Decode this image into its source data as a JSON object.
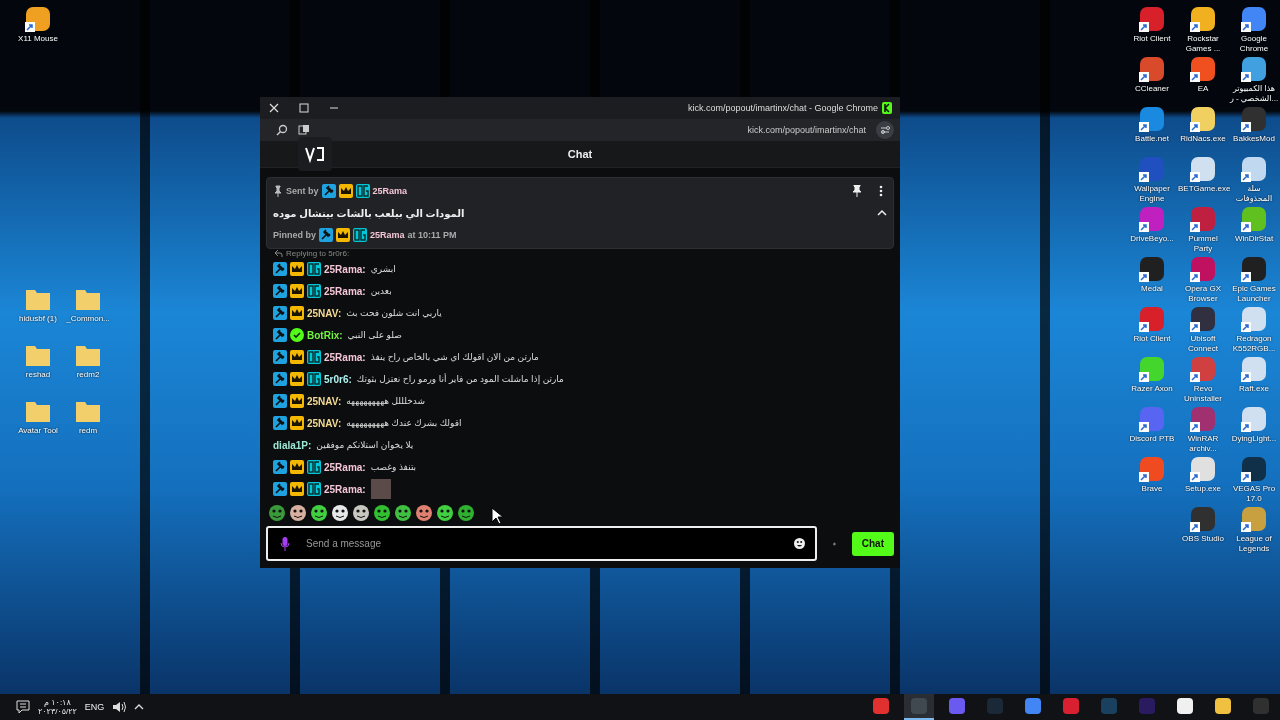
{
  "desktop": {
    "top_left_icons": [
      {
        "label": "X11 Mouse",
        "kind": "app",
        "color": "#f0a020"
      }
    ],
    "folder_icons": [
      {
        "label": "hidusbf (1)",
        "kind": "folder",
        "color": "#f2cf6a"
      },
      {
        "label": "_Common...",
        "kind": "folder",
        "color": "#f2cf6a"
      },
      {
        "label": "reshad",
        "kind": "folder",
        "color": "#f2cf6a"
      },
      {
        "label": "redm2",
        "kind": "folder",
        "color": "#f2cf6a"
      },
      {
        "label": "Avatar Tool",
        "kind": "folder",
        "color": "#f2cf6a"
      },
      {
        "label": "redm",
        "kind": "folder",
        "color": "#f2cf6a"
      }
    ],
    "icon_columns": [
      [
        {
          "label": "Riot Client",
          "kind": "app",
          "color": "#d8202a"
        },
        {
          "label": "CCleaner",
          "kind": "app",
          "color": "#d84a2a"
        },
        {
          "label": "Battle.net",
          "kind": "app",
          "color": "#1a8ae0"
        },
        {
          "label": "Wallpaper Engine",
          "kind": "app",
          "color": "#2050c0"
        },
        {
          "label": "DriveBeyo...",
          "kind": "app",
          "color": "#c020c0"
        },
        {
          "label": "Medal",
          "kind": "app",
          "color": "#202020"
        },
        {
          "label": "Riot Client",
          "kind": "app",
          "color": "#d8202a"
        },
        {
          "label": "Razer Axon",
          "kind": "app",
          "color": "#44d62c"
        },
        {
          "label": "Discord PTB",
          "kind": "app",
          "color": "#5865f2"
        },
        {
          "label": "Brave",
          "kind": "app",
          "color": "#f04a20"
        }
      ],
      [
        {
          "label": "Rockstar Games ...",
          "kind": "app",
          "color": "#f0b020"
        },
        {
          "label": "EA",
          "kind": "app",
          "color": "#f05020"
        },
        {
          "label": "RidNacs.exe",
          "kind": "app",
          "color": "#f0d060"
        },
        {
          "label": "BETGame.exe",
          "kind": "app",
          "color": "#d0e0f0"
        },
        {
          "label": "Pummel Party",
          "kind": "app",
          "color": "#c02040"
        },
        {
          "label": "Opera GX Browser",
          "kind": "app",
          "color": "#c01060"
        },
        {
          "label": "Ubisoft Connect",
          "kind": "app",
          "color": "#303040"
        },
        {
          "label": "Revo Uninstaller",
          "kind": "app",
          "color": "#d04040"
        },
        {
          "label": "WinRAR archiv...",
          "kind": "app",
          "color": "#a03070"
        },
        {
          "label": "Setup.exe",
          "kind": "app",
          "color": "#e0e0e0"
        },
        {
          "label": "OBS Studio",
          "kind": "app",
          "color": "#303030"
        }
      ],
      [
        {
          "label": "Google Chrome",
          "kind": "app",
          "color": "#4285f4"
        },
        {
          "label": "هذا الكمبيوتر الشخصي - ر...",
          "kind": "app",
          "color": "#40a0e0"
        },
        {
          "label": "BakkesMod",
          "kind": "app",
          "color": "#303030"
        },
        {
          "label": "سلة المحذوفات",
          "kind": "app",
          "color": "#c0d8f0"
        },
        {
          "label": "WinDirStat",
          "kind": "app",
          "color": "#60c020"
        },
        {
          "label": "Epic Games Launcher",
          "kind": "app",
          "color": "#202020"
        },
        {
          "label": "Redragon K552RGB...",
          "kind": "app",
          "color": "#d0e0f0"
        },
        {
          "label": "Raft.exe",
          "kind": "app",
          "color": "#d0e0f0"
        },
        {
          "label": "DyingLight...",
          "kind": "app",
          "color": "#d0e0f0"
        },
        {
          "label": "VEGAS Pro 17.0",
          "kind": "app",
          "color": "#10304a"
        },
        {
          "label": "League of Legends",
          "kind": "app",
          "color": "#c8a040"
        }
      ]
    ]
  },
  "window": {
    "title": "kick.com/popout/imartinx/chat - Google Chrome",
    "url": "kick.com/popout/imartinx/chat"
  },
  "chat": {
    "title": "Chat",
    "pinned": {
      "sent_by_label": "Sent by",
      "sender": "25Rama",
      "sender_badges": [
        {
          "kind": "mod"
        },
        {
          "kind": "crown"
        },
        {
          "kind": "og"
        }
      ],
      "message": "المودات الي بيلعب بالشات بينشال موده",
      "pinned_by_label": "Pinned by",
      "pinner": "25Rama",
      "pinner_badges": [
        {
          "kind": "mod"
        },
        {
          "kind": "crown"
        },
        {
          "kind": "og"
        }
      ],
      "time": "at 10:11 PM",
      "expanded": true
    },
    "reply_hint": "Replying to 5r0r6:",
    "messages": [
      {
        "user": "25Rama:",
        "color": "#f4c6d6",
        "badges": [
          {
            "kind": "mod"
          },
          {
            "kind": "crown"
          },
          {
            "kind": "og"
          }
        ],
        "kind": "text",
        "text": "ابشري"
      },
      {
        "user": "25Rama:",
        "color": "#f4c6d6",
        "badges": [
          {
            "kind": "mod"
          },
          {
            "kind": "crown"
          },
          {
            "kind": "og"
          }
        ],
        "kind": "text",
        "text": "بعدين"
      },
      {
        "user": "25NAV:",
        "color": "#f5dc94",
        "badges": [
          {
            "kind": "mod"
          },
          {
            "kind": "crown"
          }
        ],
        "kind": "text",
        "text": "ياربي انت شلون فحت بث"
      },
      {
        "user": "BotRix:",
        "color": "#72f542",
        "badges": [
          {
            "kind": "mod"
          },
          {
            "kind": "verified"
          }
        ],
        "kind": "text",
        "text": "صلو على النبي"
      },
      {
        "user": "25Rama:",
        "color": "#f4c6d6",
        "badges": [
          {
            "kind": "mod"
          },
          {
            "kind": "crown"
          },
          {
            "kind": "og"
          }
        ],
        "kind": "text",
        "text": "مارتن من الان اقولك اي شي بالخاص راح ينفذ"
      },
      {
        "user": "5r0r6:",
        "color": "#aef2ee",
        "badges": [
          {
            "kind": "mod"
          },
          {
            "kind": "crown"
          },
          {
            "kind": "og"
          }
        ],
        "kind": "text",
        "text": "مارتن إذا ماشلت المود من فاير أنا ورمو راح نعتزل بثوتك"
      },
      {
        "user": "25NAV:",
        "color": "#f5dc94",
        "badges": [
          {
            "kind": "mod"
          },
          {
            "kind": "crown"
          }
        ],
        "kind": "text",
        "text": "شدخلللل هههههههههه"
      },
      {
        "user": "25NAV:",
        "color": "#f5dc94",
        "badges": [
          {
            "kind": "mod"
          },
          {
            "kind": "crown"
          }
        ],
        "kind": "text",
        "text": "اقولك بشرك عندك هههههههههه"
      },
      {
        "user": "diala1P:",
        "color": "#9ee8d6",
        "kind": "text",
        "text": "يلا يخوان استلانكم موفقين"
      },
      {
        "user": "25Rama:",
        "color": "#f4c6d6",
        "badges": [
          {
            "kind": "mod"
          },
          {
            "kind": "crown"
          },
          {
            "kind": "og"
          }
        ],
        "kind": "text",
        "text": "بتنفذ وغصب"
      },
      {
        "user": "25Rama:",
        "color": "#f4c6d6",
        "badges": [
          {
            "kind": "mod"
          },
          {
            "kind": "crown"
          },
          {
            "kind": "og"
          }
        ],
        "kind": "image"
      }
    ],
    "emotes": [
      {
        "color": "#3a9a3a"
      },
      {
        "color": "#d8b0a0"
      },
      {
        "color": "#40d040"
      },
      {
        "color": "#e8e8e8"
      },
      {
        "color": "#c8c8c0"
      },
      {
        "color": "#30c030"
      },
      {
        "color": "#40c040"
      },
      {
        "color": "#e08070"
      },
      {
        "color": "#40d040"
      },
      {
        "color": "#30b030"
      }
    ],
    "input": {
      "placeholder": "Send a message"
    },
    "send_button": "Chat"
  },
  "taskbar": {
    "clock_time": "١٠:١٨ م",
    "clock_date": "٢٠٢٣/٠٥/٢٢",
    "language": "ENG",
    "apps": [
      {
        "color": "#e03030",
        "active": false
      },
      {
        "color": "#404850",
        "active": true
      },
      {
        "color": "#6a5af0",
        "active": false
      },
      {
        "color": "#1b2838",
        "active": false
      },
      {
        "color": "#4285f4",
        "active": false
      },
      {
        "color": "#d82030",
        "active": false
      },
      {
        "color": "#1a4060",
        "active": false
      },
      {
        "color": "#2a1a60",
        "active": false
      },
      {
        "color": "#f0f0f0",
        "active": false
      },
      {
        "color": "#f0c040",
        "active": false
      },
      {
        "color": "#303030",
        "active": false
      }
    ]
  }
}
